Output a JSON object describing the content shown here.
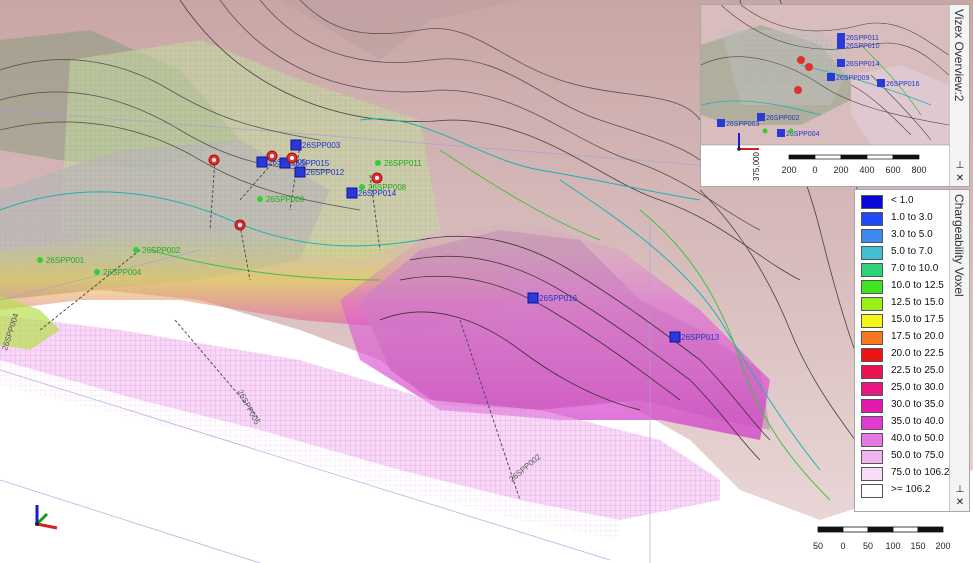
{
  "viewer": {
    "collar_labels": [
      {
        "text": "26SPP003",
        "color": "#2233cc"
      },
      {
        "text": "26SPP011",
        "color": "#22aa22"
      },
      {
        "text": "26SPP015",
        "color": "#2233cc"
      },
      {
        "text": "26SPP012",
        "color": "#2233cc"
      },
      {
        "text": "26SPP008",
        "color": "#22aa22"
      },
      {
        "text": "26SPP014",
        "color": "#2233cc"
      },
      {
        "text": "26SPP009",
        "color": "#22aa22"
      },
      {
        "text": "26SPP004",
        "color": "#22aa22"
      },
      {
        "text": "26SPP002",
        "color": "#22aa22"
      },
      {
        "text": "26SPP001",
        "color": "#22aa22"
      },
      {
        "text": "26SPP016",
        "color": "#2233cc"
      },
      {
        "text": "26SPP013",
        "color": "#2233cc"
      },
      {
        "text": "26SPP005",
        "color": "#2233cc"
      },
      {
        "text": "26SPP004",
        "color": "#555555"
      },
      {
        "text": "26SPP005",
        "color": "#555555"
      },
      {
        "text": "26SPP002",
        "color": "#555555"
      }
    ],
    "scalebar": {
      "labels": [
        "50",
        "0",
        "50",
        "100",
        "150",
        "200"
      ]
    }
  },
  "overview": {
    "title": "Vizex Overview:2",
    "pin_label": "⊥",
    "close_label": "✕",
    "collar_labels": [
      "26SPP011",
      "26SPP010",
      "26SPP014",
      "26SPP009",
      "26SPP016",
      "26SPP003",
      "26SPP002",
      "26SPP004"
    ],
    "axis_label": "375,000",
    "scalebar": {
      "labels": [
        "200",
        "0",
        "200",
        "400",
        "600",
        "800"
      ]
    }
  },
  "legend": {
    "title": "Chargeability Voxel",
    "pin_label": "⊥",
    "close_label": "✕",
    "items": [
      {
        "label": "< 1.0",
        "color": "#0a0ad8"
      },
      {
        "label": "1.0 to 3.0",
        "color": "#1f4af5"
      },
      {
        "label": "3.0 to 5.0",
        "color": "#3c8af0"
      },
      {
        "label": "5.0 to 7.0",
        "color": "#3fc0d0"
      },
      {
        "label": "7.0 to 10.0",
        "color": "#2ed37a"
      },
      {
        "label": "10.0 to 12.5",
        "color": "#3ee51f"
      },
      {
        "label": "12.5 to 15.0",
        "color": "#9aee1a"
      },
      {
        "label": "15.0 to 17.5",
        "color": "#f6f614"
      },
      {
        "label": "17.5 to 20.0",
        "color": "#f9781c"
      },
      {
        "label": "20.0 to 22.5",
        "color": "#ee1414"
      },
      {
        "label": "22.5 to 25.0",
        "color": "#e81550"
      },
      {
        "label": "25.0 to 30.0",
        "color": "#e81880"
      },
      {
        "label": "30.0 to 35.0",
        "color": "#e21ab0"
      },
      {
        "label": "35.0 to 40.0",
        "color": "#e03cd4"
      },
      {
        "label": "40.0 to 50.0",
        "color": "#e678e4"
      },
      {
        "label": "50.0 to 75.0",
        "color": "#f0b2f0"
      },
      {
        "label": "75.0 to 106.2",
        "color": "#f9dcf8"
      },
      {
        "label": ">= 106.2",
        "color": "#ffffff"
      }
    ]
  },
  "axes": {
    "x_color": "#d42020",
    "y_color": "#10a010",
    "z_color": "#1a1ad8"
  }
}
